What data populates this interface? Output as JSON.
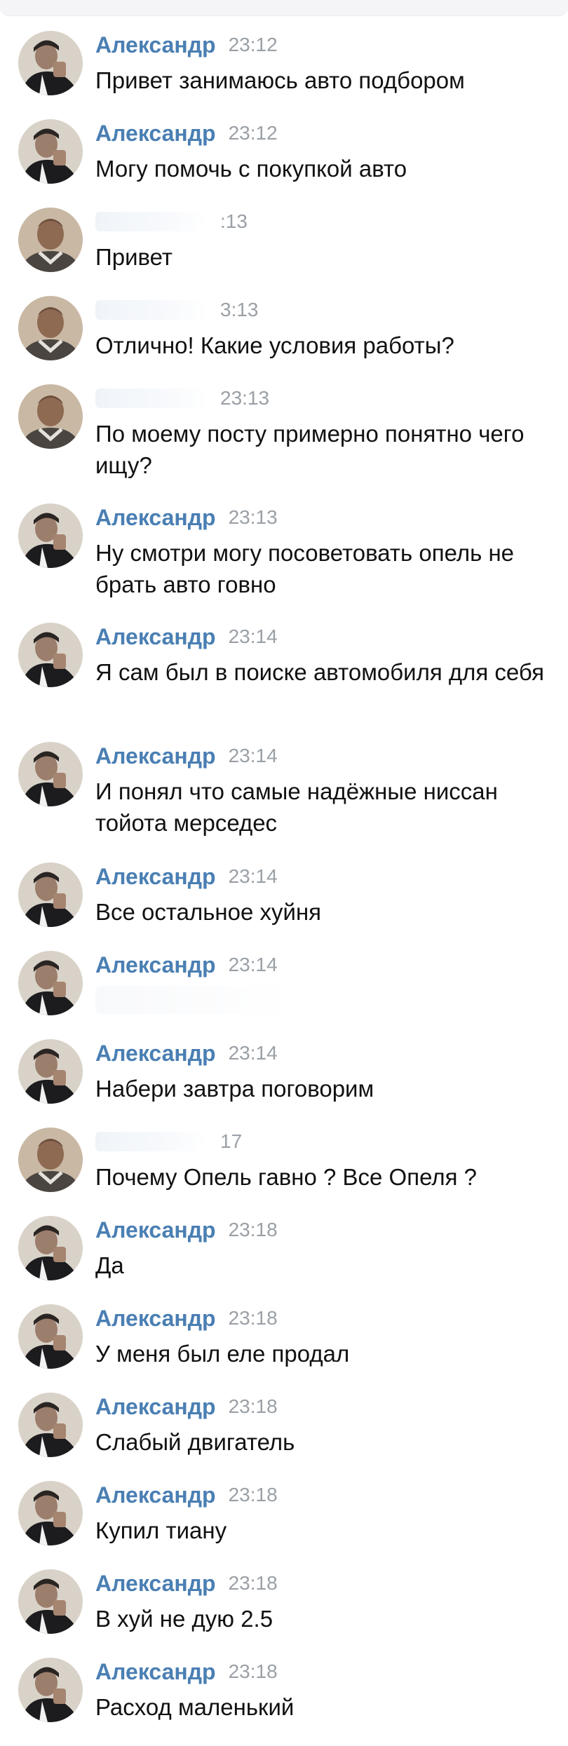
{
  "author_name": "Александр",
  "icons": {
    "avatar_a": "avatar-photo-dark-shirt",
    "avatar_b": "avatar-photo-bald-man"
  },
  "colors": {
    "name": "#4a7fb3",
    "time": "#9aa0a6",
    "text": "#111111"
  },
  "messages": [
    {
      "sender": "Александр",
      "time": "23:12",
      "text": "Привет занимаюсь авто подбором"
    },
    {
      "sender": "Александр",
      "time": "23:12",
      "text": "Могу помочь с покупкой авто"
    },
    {
      "sender": "",
      "time": ":13",
      "text": "Привет"
    },
    {
      "sender": "",
      "time": "3:13",
      "text": "Отлично! Какие условия работы?"
    },
    {
      "sender": "",
      "time": "23:13",
      "text": "По моему посту примерно понятно чего ищу?"
    },
    {
      "sender": "Александр",
      "time": "23:13",
      "text": "Ну смотри могу посоветовать опель не брать авто говно"
    },
    {
      "sender": "Александр",
      "time": "23:14",
      "text": "Я сам был в поиске автомобиля для себя"
    },
    {
      "sender": "Александр",
      "time": "23:14",
      "text": "И понял что самые надёжные ниссан тойота мерседес"
    },
    {
      "sender": "Александр",
      "time": "23:14",
      "text": "Все остальное хуйня"
    },
    {
      "sender": "Александр",
      "time": "23:14",
      "text": ""
    },
    {
      "sender": "Александр",
      "time": "23:14",
      "text": "Набери завтра поговорим"
    },
    {
      "sender": "",
      "time": "17",
      "text": "Почему Опель гавно ? Все Опеля ?"
    },
    {
      "sender": "Александр",
      "time": "23:18",
      "text": "Да"
    },
    {
      "sender": "Александр",
      "time": "23:18",
      "text": "У меня был еле продал"
    },
    {
      "sender": "Александр",
      "time": "23:18",
      "text": "Слабый двигатель"
    },
    {
      "sender": "Александр",
      "time": "23:18",
      "text": "Купил тиану"
    },
    {
      "sender": "Александр",
      "time": "23:18",
      "text": "В хуй не дую 2.5"
    },
    {
      "sender": "Александр",
      "time": "23:18",
      "text": "Расход маленький"
    }
  ]
}
